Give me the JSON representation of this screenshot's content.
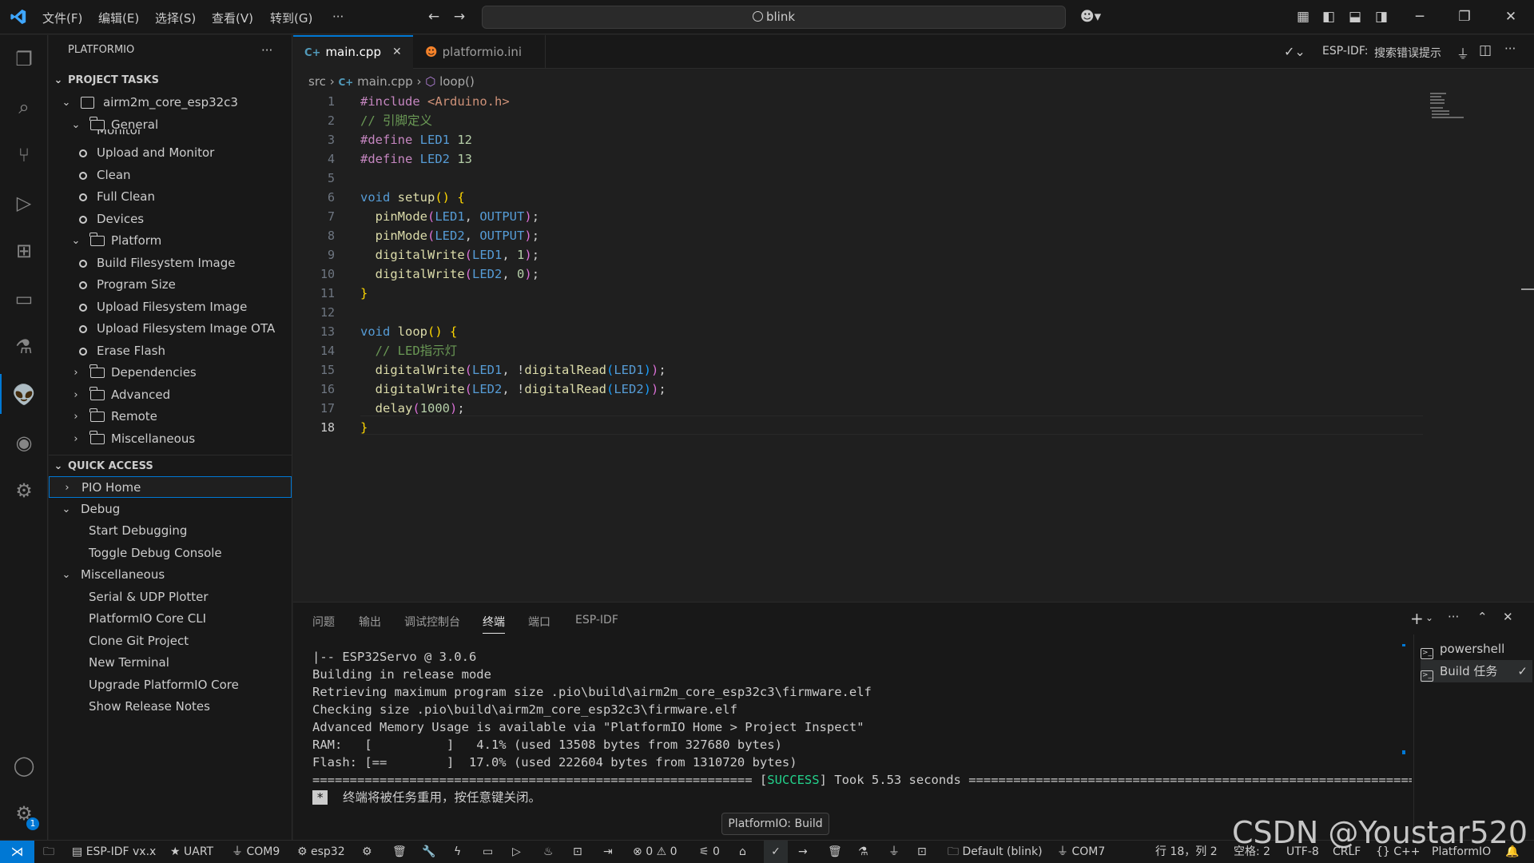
{
  "titlebar": {
    "menus": [
      "文件(F)",
      "编辑(E)",
      "选择(S)",
      "查看(V)",
      "转到(G)",
      "···"
    ],
    "search_text": "blink"
  },
  "sidebar": {
    "title": "PLATFORMIO",
    "more": "···",
    "project_tasks_header": "PROJECT TASKS",
    "env_name": "airm2m_core_esp32c3",
    "general_folder": "General",
    "partial_item": "Monitor",
    "general_items": [
      "Upload and Monitor",
      "Clean",
      "Full Clean",
      "Devices"
    ],
    "platform_folder": "Platform",
    "platform_items": [
      "Build Filesystem Image",
      "Program Size",
      "Upload Filesystem Image",
      "Upload Filesystem Image OTA",
      "Erase Flash"
    ],
    "collapsed_folders": [
      "Dependencies",
      "Advanced",
      "Remote",
      "Miscellaneous"
    ],
    "quick_access_header": "QUICK ACCESS",
    "pio_home": "PIO Home",
    "debug_group": "Debug",
    "debug_items": [
      "Start Debugging",
      "Toggle Debug Console"
    ],
    "misc_group": "Miscellaneous",
    "misc_items": [
      "Serial & UDP Plotter",
      "PlatformIO Core CLI",
      "Clone Git Project",
      "New Terminal",
      "Upgrade PlatformIO Core",
      "Show Release Notes"
    ]
  },
  "editor": {
    "tabs": [
      {
        "label": "main.cpp",
        "icon": "cpp-file-icon",
        "active": true
      },
      {
        "label": "platformio.ini",
        "icon": "platformio-ini-icon",
        "active": false
      }
    ],
    "tab_close": "✕",
    "toolbar_label": "ESP-IDF:",
    "toolbar_action": "搜索错误提示",
    "breadcrumb": {
      "folder": "src",
      "file": "main.cpp",
      "symbol": "loop()"
    },
    "current_line": 18,
    "lines": [
      "1",
      "2",
      "3",
      "4",
      "5",
      "6",
      "7",
      "8",
      "9",
      "10",
      "11",
      "12",
      "13",
      "14",
      "15",
      "16",
      "17",
      "18"
    ],
    "code": {
      "include_kw": "#include",
      "include_file": "<Arduino.h>",
      "comment_pins": "// 引脚定义",
      "define_kw": "#define",
      "led1": "LED1",
      "led2": "LED2",
      "v12": "12",
      "v13": "13",
      "void_kw": "void",
      "setup_fn": "setup",
      "loop_fn": "loop",
      "pinmode": "pinMode",
      "output": "OUTPUT",
      "digitalwrite": "digitalWrite",
      "digitalread": "digitalRead",
      "one": "1",
      "zero": "0",
      "comment_led": "// LED指示灯",
      "delay": "delay",
      "delay_val": "1000"
    }
  },
  "panel": {
    "tabs": [
      "问题",
      "输出",
      "调试控制台",
      "终端",
      "端口",
      "ESP-IDF"
    ],
    "active_tab": "终端",
    "terminal_lines": [
      "|-- ESP32Servo @ 3.0.6",
      "Building in release mode",
      "Retrieving maximum program size .pio\\build\\airm2m_core_esp32c3\\firmware.elf",
      "Checking size .pio\\build\\airm2m_core_esp32c3\\firmware.elf",
      "Advanced Memory Usage is available via \"PlatformIO Home > Project Inspect\"",
      "RAM:   [          ]   4.1% (used 13508 bytes from 327680 bytes)",
      "Flash: [==        ]  17.0% (used 222604 bytes from 1310720 bytes)"
    ],
    "success_prefix": "=========================================================== [",
    "success_word": "SUCCESS",
    "success_suffix": "] Took 5.53 seconds =============================================================",
    "reuse_marker": "*",
    "reuse_msg": "终端将被任务重用，按任意键关闭。",
    "terminals": [
      "powershell",
      "Build 任务"
    ],
    "tooltip": "PlatformIO: Build"
  },
  "statusbar": {
    "espidf": "ESP-IDF vx.x",
    "uart": "UART",
    "com9": "COM9",
    "target": "esp32",
    "errors": "0",
    "warnings": "0",
    "ports": "0",
    "project_env": "Default (blink)",
    "com7": "COM7",
    "cursor_pos": "行 18，列 2",
    "spaces": "空格: 2",
    "encoding": "UTF-8",
    "eol": "CRLF",
    "language": "C++",
    "platformio": "PlatformIO"
  },
  "notifications_badge": "1",
  "watermark": "CSDN @Youstar520",
  "colors": {
    "accent": "#0078d4",
    "success": "#23d18b"
  }
}
